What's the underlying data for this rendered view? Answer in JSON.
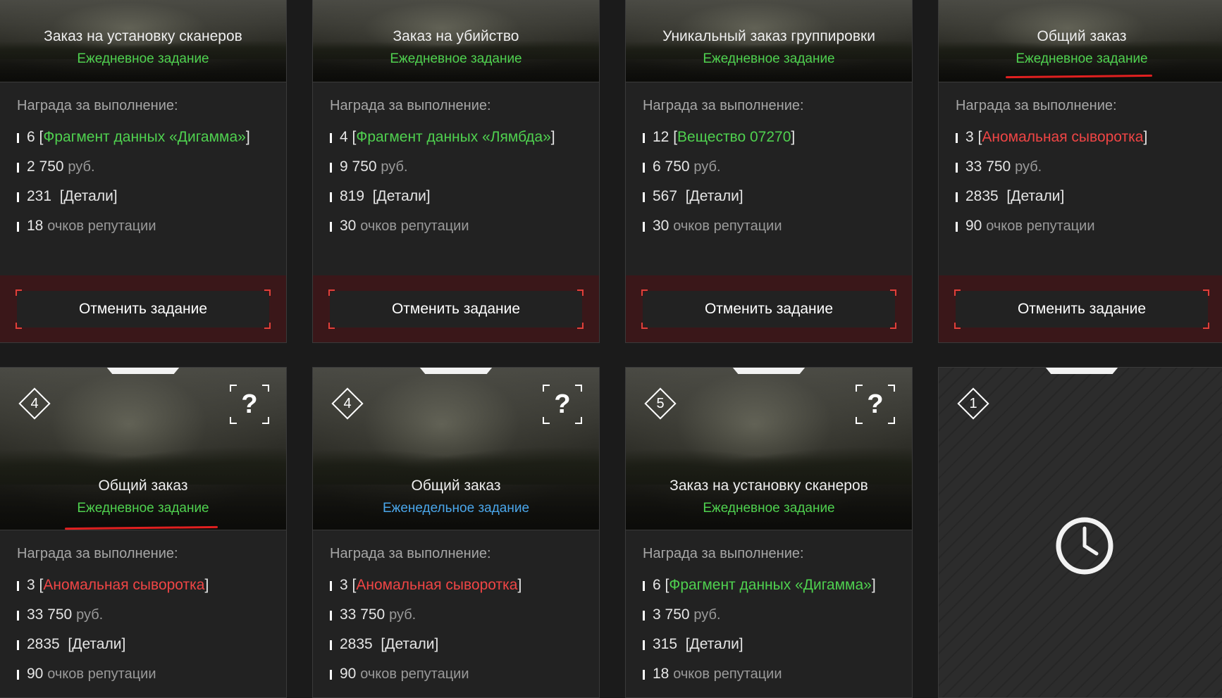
{
  "common": {
    "reward_label": "Награда за выполнение:",
    "cancel_label": "Отменить задание",
    "rub": "руб.",
    "rep": "очков репутации"
  },
  "cards": [
    {
      "title": "Заказ на установку сканеров",
      "type": "Ежедневное задание",
      "item_count": "6",
      "item_name": "Фрагмент данных «Дигамма»",
      "money": "2 750",
      "parts": "231",
      "parts_label": "[Детали]",
      "rep": "18"
    },
    {
      "title": "Заказ на убийство",
      "type": "Ежедневное задание",
      "item_count": "4",
      "item_name": "Фрагмент данных «Лямбда»",
      "money": "9 750",
      "parts": "819",
      "parts_label": "[Детали]",
      "rep": "30"
    },
    {
      "title": "Уникальный заказ группировки",
      "type": "Ежедневное задание",
      "item_count": "12",
      "item_name": "Вещество 07270",
      "money": "6 750",
      "parts": "567",
      "parts_label": "[Детали]",
      "rep": "30"
    },
    {
      "title": "Общий заказ",
      "type": "Ежедневное задание",
      "item_count": "3",
      "item_name": "Аномальная сыворотка",
      "money": "33 750",
      "parts": "2835",
      "parts_label": "[Детали]",
      "rep": "90"
    },
    {
      "tier": "4",
      "title": "Общий заказ",
      "type": "Ежедневное задание",
      "item_count": "3",
      "item_name": "Аномальная сыворотка",
      "money": "33 750",
      "parts": "2835",
      "parts_label": "[Детали]",
      "rep": "90"
    },
    {
      "tier": "4",
      "title": "Общий заказ",
      "type": "Еженедельное задание",
      "item_count": "3",
      "item_name": "Аномальная сыворотка",
      "money": "33 750",
      "parts": "2835",
      "parts_label": "[Детали]",
      "rep": "90"
    },
    {
      "tier": "5",
      "title": "Заказ на установку сканеров",
      "type": "Ежедневное задание",
      "item_count": "6",
      "item_name": "Фрагмент данных «Дигамма»",
      "money": "3 750",
      "parts": "315",
      "parts_label": "[Детали]",
      "rep": "18"
    },
    {
      "tier": "1"
    }
  ],
  "colors": {
    "daily": "#4fd14f",
    "weekly": "#4aa6ea",
    "rare_item": "#f04545",
    "common_item": "#4fd14f",
    "cancel_bg": "#3a1719",
    "highlight_underline": "#e02020"
  },
  "icons": {
    "unknown": "question-mark-icon",
    "tier": "diamond-tier-icon",
    "cooldown": "clock-icon"
  }
}
